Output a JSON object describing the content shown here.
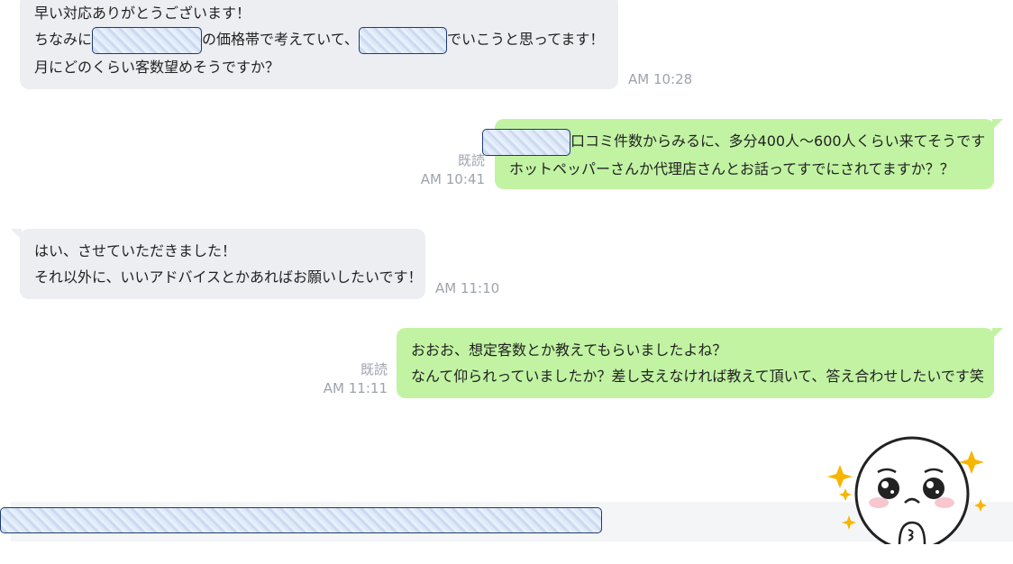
{
  "messages": [
    {
      "id": "m1",
      "direction": "incoming",
      "lines": [
        "早い対応ありがとうございます！",
        "ちなみに",
        "の価格帯で考えていて、",
        "でいこうと思ってます！",
        "月にどのくらい客数望めそうですか？"
      ],
      "time": "AM 10:28"
    },
    {
      "id": "m2",
      "direction": "outgoing",
      "lines": [
        "口コミ件数からみるに、多分400人～600人くらい来てそうです",
        "ホットペッパーさんか代理店さんとお話ってすでにされてますか？？"
      ],
      "read": "既読",
      "time": "AM 10:41"
    },
    {
      "id": "m3",
      "direction": "incoming",
      "lines": [
        "はい、させていただきました！",
        "それ以外に、いいアドバイスとかあればお願いしたいです！"
      ],
      "time": "AM 11:10"
    },
    {
      "id": "m4",
      "direction": "outgoing",
      "lines": [
        "おおお、想定客数とか教えてもらいましたよね？",
        "なんて仰られっていましたか？差し支えなければ教えて頂いて、答え合わせしたいです笑"
      ],
      "read": "既読",
      "time": "AM 11:11"
    }
  ],
  "sticker": {
    "icon": "crying-face-sticker-icon",
    "sparkle_color": "#f7b500"
  },
  "colors": {
    "outgoing_bubble": "#c1f3a3",
    "incoming_bubble": "#edeef2",
    "meta_text": "#9ea3ad"
  }
}
